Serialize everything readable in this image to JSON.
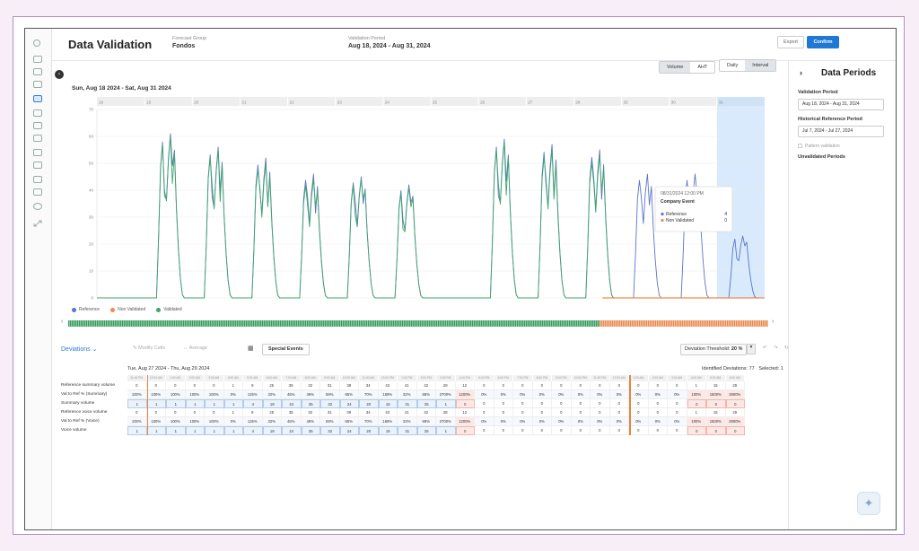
{
  "header": {
    "title": "Data Validation",
    "forecast_group_label": "Forecast Group",
    "forecast_group_value": "Fondos",
    "validation_period_label": "Validation Period",
    "validation_period_value": "Aug 18, 2024 - Aug 31, 2024",
    "export_label": "Export",
    "confirm_label": "Confirm"
  },
  "chart_controls": {
    "metric_toggle": [
      "Volume",
      "AHT"
    ],
    "metric_selected": "Volume",
    "granularity_toggle": [
      "Daily",
      "Interval"
    ],
    "granularity_selected": "Interval",
    "range_label": "Sun, Aug 18 2024 - Sat, Aug 31 2024"
  },
  "chart_data": {
    "type": "line",
    "x_day_labels": [
      "18",
      "19",
      "20",
      "21",
      "22",
      "23",
      "24",
      "25",
      "26",
      "27",
      "28",
      "29",
      "30",
      "31"
    ],
    "y_ticks": [
      0,
      10,
      20,
      30,
      40,
      50,
      60,
      70
    ],
    "ylim": [
      0,
      70
    ],
    "series": [
      {
        "name": "Reference",
        "color": "#5b74c9",
        "daily_peaks": [
          0,
          61,
          56,
          52,
          46,
          45,
          42,
          0,
          59,
          57,
          55,
          46,
          46,
          23
        ]
      },
      {
        "name": "Validated",
        "color": "#3fa56b",
        "daily_peaks": [
          0,
          60,
          55,
          50,
          44,
          44,
          41,
          0,
          58,
          55,
          53,
          0,
          0,
          0
        ]
      },
      {
        "name": "Non Validated",
        "color": "#ef8a52",
        "daily_peaks": [
          0,
          0,
          0,
          0,
          0,
          0,
          0,
          0,
          0,
          0,
          0,
          0,
          0,
          0
        ]
      }
    ],
    "highlight_day": "31",
    "legend_position": "bottom-left",
    "grid": true
  },
  "tooltip": {
    "datetime": "08/31/2024 12:00 PM",
    "event": "Company Event",
    "rows": [
      {
        "label": "Reference",
        "value": "4",
        "color": "#5b74c9"
      },
      {
        "label": "Non Validated",
        "value": "0",
        "color": "#ef8a52"
      }
    ]
  },
  "legend": [
    "Reference",
    "Non Validated",
    "Validated"
  ],
  "right_panel": {
    "title": "Data Periods",
    "validation_period_label": "Validation Period",
    "validation_period_value": "Aug 18, 2024 - Aug 31, 2024",
    "historical_label": "Historical Reference Period",
    "historical_value": "Jul 7, 2024 - Jul 27, 2024",
    "pattern_validation": "Pattern validation",
    "unvalidated_label": "Unvalidated Periods"
  },
  "toolbar": {
    "deviations_label": "Deviations",
    "modify_cells": "Modify Cells",
    "average": "Average",
    "special_events": "Special Events",
    "threshold_label": "Deviation Threshold:",
    "threshold_value": "20 %"
  },
  "table": {
    "range": "Tue, Aug 27 2024 - Thu, Aug 29 2024",
    "identified": "Identified Deviations: 77",
    "selected": "Selected: 1",
    "times": [
      "11:00 PM",
      "12:00 AM",
      "1:00 AM",
      "2:00 AM",
      "3:00 AM",
      "4:00 AM",
      "5:00 AM",
      "6:00 AM",
      "7:00 AM",
      "8:00 AM",
      "9:00 AM",
      "10:00 AM",
      "11:00 AM",
      "12:00 PM",
      "1:00 PM",
      "2:00 PM",
      "3:00 PM",
      "4:00 PM",
      "5:00 PM",
      "6:00 PM",
      "7:00 PM",
      "8:00 PM",
      "9:00 PM",
      "10:00 PM",
      "11:00 PM",
      "12:00 AM",
      "1:00 AM",
      "2:00 AM",
      "3:00 AM",
      "4:00 AM",
      "5:00 AM",
      "6:00 AM"
    ],
    "rows": [
      {
        "label": "Reference summary volume",
        "values": [
          "0",
          "0",
          "0",
          "0",
          "0",
          "1",
          "9",
          "25",
          "35",
          "32",
          "31",
          "39",
          "34",
          "43",
          "41",
          "42",
          "28",
          "12",
          "0",
          "0",
          "0",
          "0",
          "0",
          "0",
          "0",
          "0",
          "0",
          "0",
          "0",
          "1",
          "15",
          "29"
        ]
      },
      {
        "label": "Val to Ref % (Summary)",
        "values": [
          "100%",
          "100%",
          "100%",
          "100%",
          "100%",
          "0%",
          "125%",
          "32%",
          "46%",
          "49%",
          "59%",
          "65%",
          "70%",
          "169%",
          "32%",
          "68%",
          "2700%",
          "1200%",
          "0%",
          "0%",
          "0%",
          "0%",
          "0%",
          "0%",
          "0%",
          "0%",
          "0%",
          "0%",
          "0%",
          "100%",
          "1500%",
          "2900%"
        ]
      },
      {
        "label": "Summary volume",
        "values": [
          "1",
          "1",
          "1",
          "1",
          "1",
          "1",
          "4",
          "19",
          "24",
          "35",
          "32",
          "24",
          "20",
          "16",
          "31",
          "25",
          "1",
          "0",
          "0",
          "0",
          "0",
          "0",
          "0",
          "0",
          "0",
          "0",
          "0",
          "0",
          "0",
          "0",
          "0",
          "0"
        ]
      },
      {
        "label": "Reference voice volume",
        "values": [
          "0",
          "0",
          "0",
          "0",
          "0",
          "1",
          "9",
          "25",
          "35",
          "32",
          "31",
          "39",
          "34",
          "43",
          "41",
          "42",
          "28",
          "12",
          "0",
          "0",
          "0",
          "0",
          "0",
          "0",
          "0",
          "0",
          "0",
          "0",
          "0",
          "1",
          "15",
          "29"
        ]
      },
      {
        "label": "Val to Ref % (Voice)",
        "values": [
          "100%",
          "100%",
          "100%",
          "100%",
          "100%",
          "0%",
          "125%",
          "32%",
          "46%",
          "49%",
          "59%",
          "65%",
          "70%",
          "169%",
          "32%",
          "68%",
          "2700%",
          "1200%",
          "0%",
          "0%",
          "0%",
          "0%",
          "0%",
          "0%",
          "0%",
          "0%",
          "0%",
          "0%",
          "0%",
          "100%",
          "1500%",
          "2900%"
        ]
      },
      {
        "label": "Voice volume",
        "values": [
          "1",
          "1",
          "1",
          "1",
          "1",
          "1",
          "4",
          "19",
          "24",
          "35",
          "32",
          "24",
          "20",
          "16",
          "31",
          "25",
          "1",
          "0",
          "0",
          "0",
          "0",
          "0",
          "0",
          "0",
          "0",
          "0",
          "0",
          "0",
          "0",
          "0",
          "0",
          "0"
        ]
      }
    ]
  }
}
